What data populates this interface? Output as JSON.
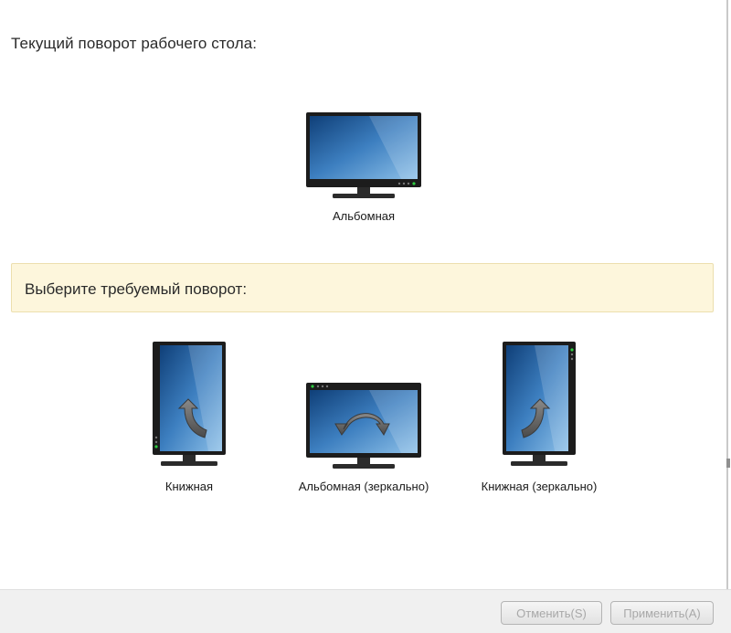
{
  "current": {
    "title": "Текущий поворот рабочего стола:",
    "label": "Альбомная"
  },
  "choose": {
    "title": "Выберите требуемый поворот:",
    "options": [
      {
        "label": "Книжная",
        "icon": "monitor-portrait-rotate-left-icon"
      },
      {
        "label": "Альбомная (зеркально)",
        "icon": "monitor-landscape-flipped-rotate-icon"
      },
      {
        "label": "Книжная (зеркально)",
        "icon": "monitor-portrait-flipped-rotate-right-icon"
      }
    ]
  },
  "footer": {
    "cancel_label": "Отменить(S)",
    "apply_label": "Применить(A)"
  },
  "colors": {
    "banner_bg": "#fdf6dc",
    "screen_blue": "#3d7fc0",
    "bezel": "#1c1c1c",
    "led_green": "#2ecc40"
  }
}
